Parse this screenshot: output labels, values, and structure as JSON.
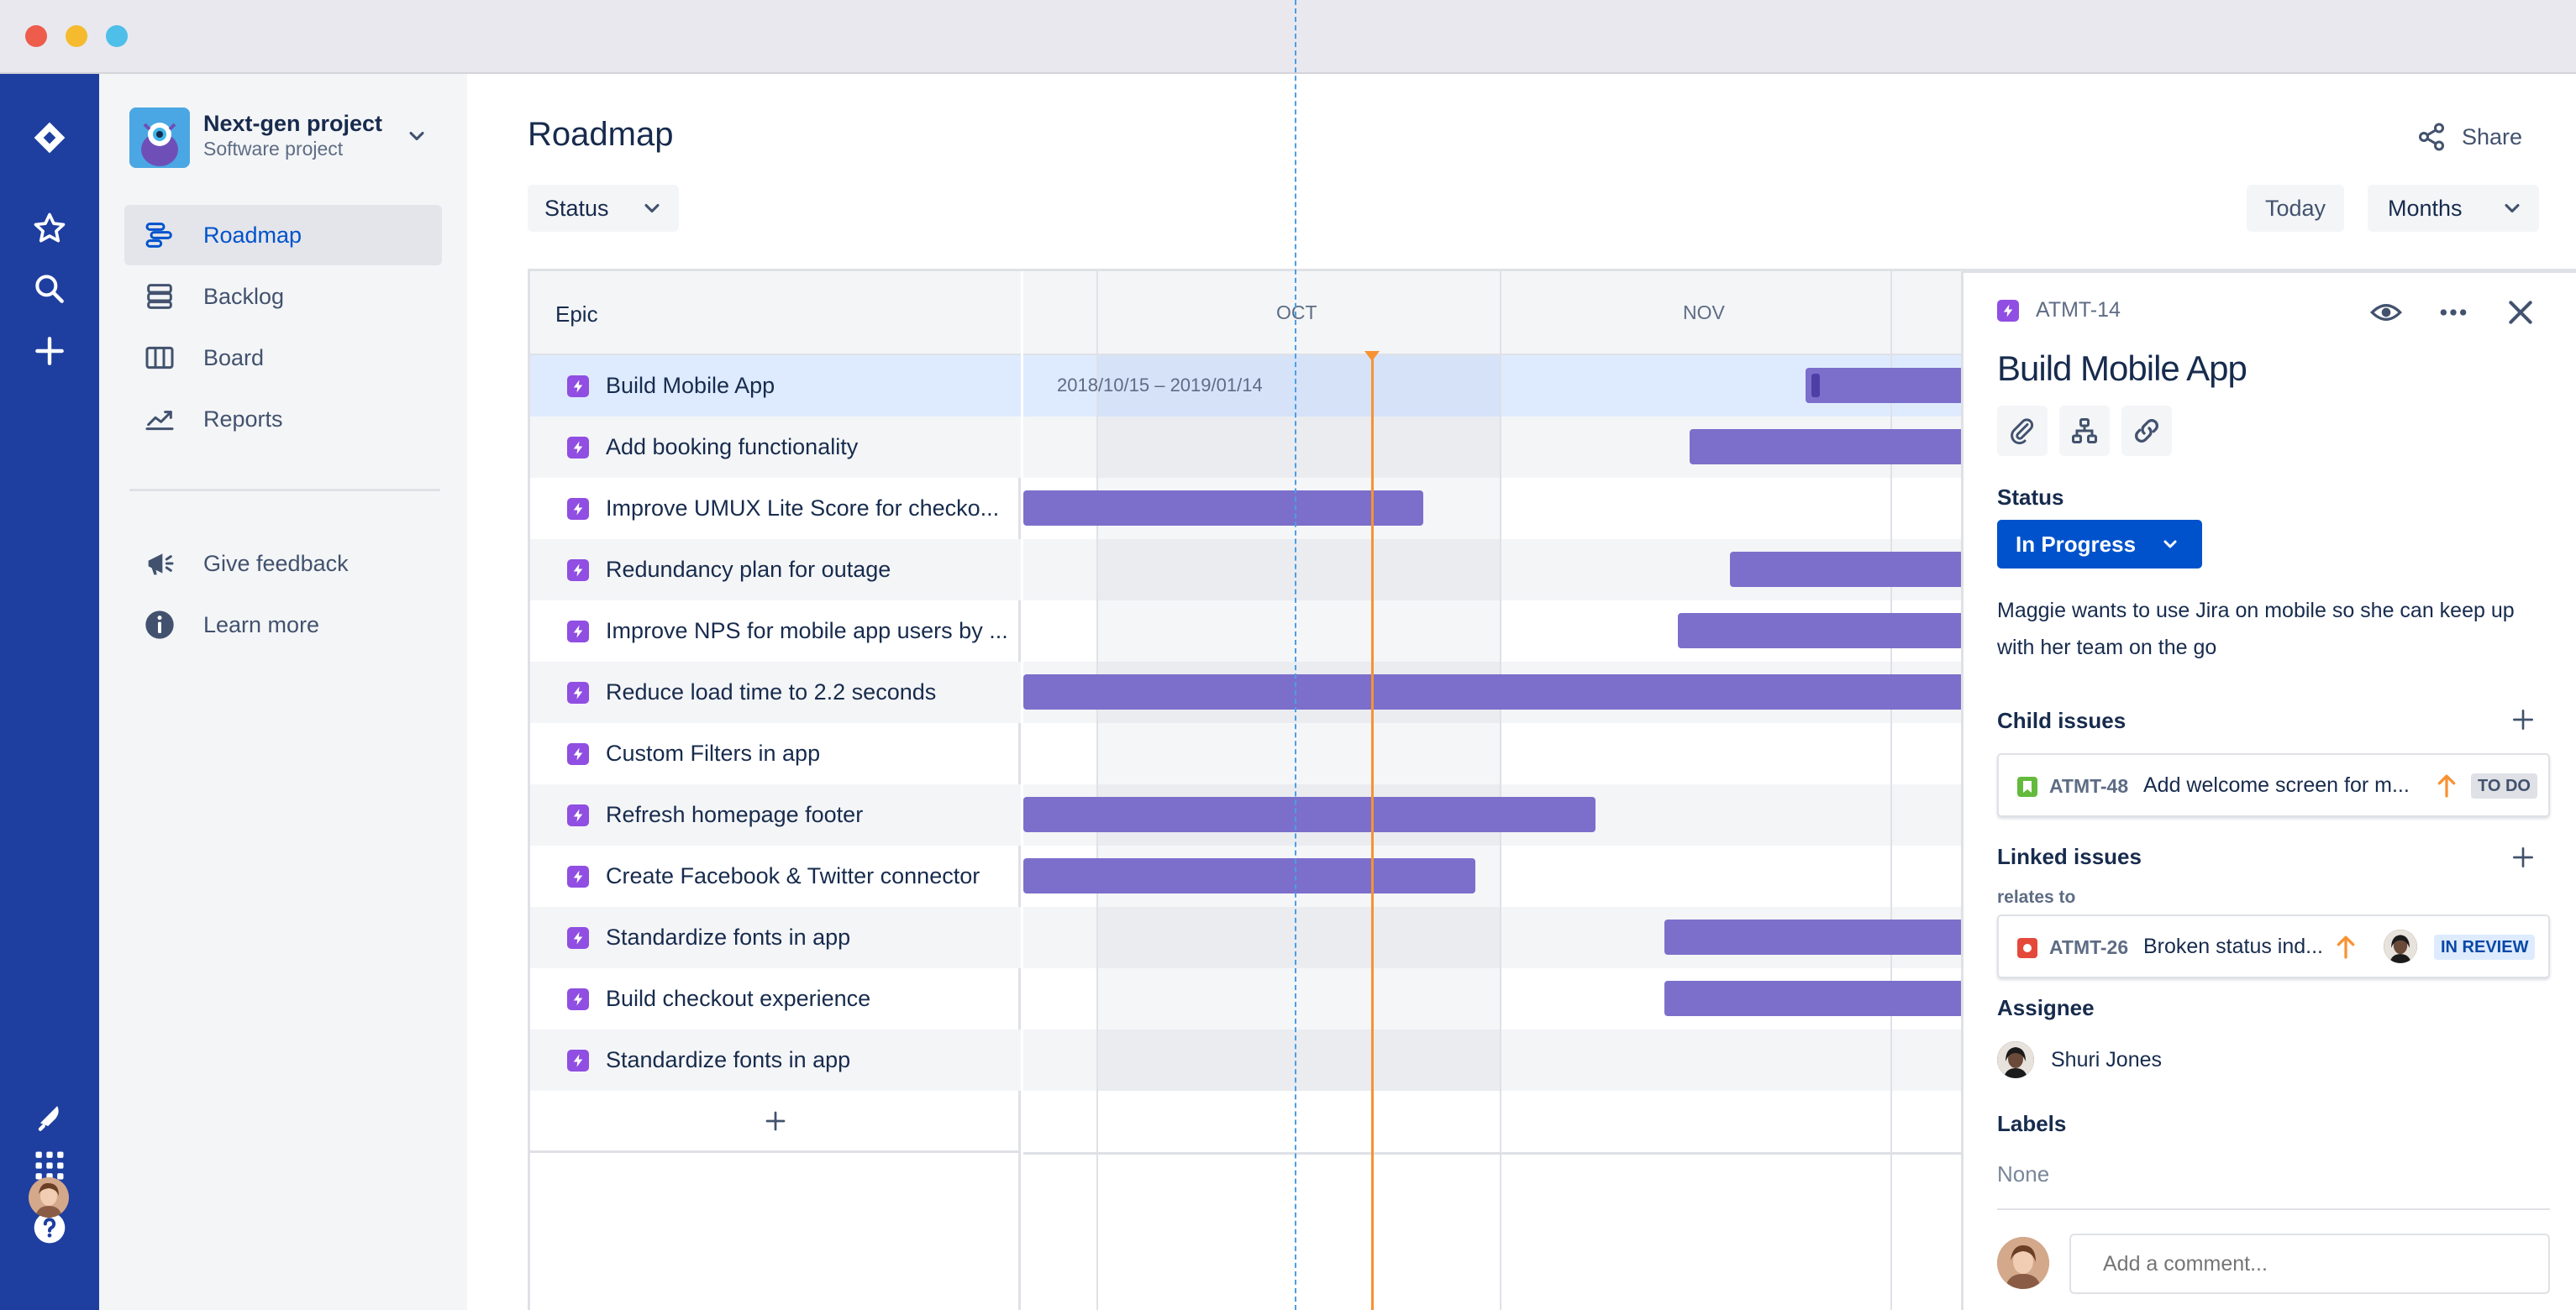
{
  "window": {
    "controls": [
      "close",
      "minimize",
      "maximize"
    ]
  },
  "global_nav": {
    "icons": [
      "jira-logo-icon",
      "star-icon",
      "search-icon",
      "plus-icon",
      "notifications-icon",
      "app-switcher-icon",
      "help-icon",
      "user-avatar"
    ],
    "background": "#1E3FA0"
  },
  "project": {
    "name": "Next-gen project",
    "type": "Software project"
  },
  "sidebar": {
    "items": [
      {
        "label": "Roadmap",
        "icon": "roadmap-icon",
        "active": true
      },
      {
        "label": "Backlog",
        "icon": "backlog-icon",
        "active": false
      },
      {
        "label": "Board",
        "icon": "board-icon",
        "active": false
      },
      {
        "label": "Reports",
        "icon": "reports-icon",
        "active": false
      }
    ],
    "secondary": [
      {
        "label": "Give feedback",
        "icon": "megaphone-icon"
      },
      {
        "label": "Learn more",
        "icon": "info-icon"
      }
    ]
  },
  "header": {
    "title": "Roadmap",
    "share_label": "Share",
    "status_filter": "Status",
    "today_label": "Today",
    "view_mode": "Months"
  },
  "roadmap": {
    "epic_header": "Epic",
    "months": [
      "OCT",
      "NOV"
    ],
    "selected_date_range": "2018/10/15 – 2019/01/14",
    "epics": [
      {
        "label": "Build Mobile App"
      },
      {
        "label": "Add booking functionality"
      },
      {
        "label": "Improve UMUX Lite Score for checko..."
      },
      {
        "label": "Redundancy plan for outage"
      },
      {
        "label": "Improve NPS for mobile app users by ..."
      },
      {
        "label": "Reduce load time to 2.2 seconds"
      },
      {
        "label": "Custom Filters in app"
      },
      {
        "label": "Refresh homepage footer"
      },
      {
        "label": "Create Facebook & Twitter connector"
      },
      {
        "label": "Standardize fonts in app"
      },
      {
        "label": "Build checkout experience"
      },
      {
        "label": "Standardize fonts in app"
      }
    ],
    "add_label": "+",
    "bar_color": "#7B6FCB",
    "today_color": "#F79233"
  },
  "panel": {
    "issue_key": "ATMT-14",
    "title": "Build Mobile App",
    "status_label": "Status",
    "status_value": "In Progress",
    "description": "Maggie wants to use Jira on mobile so she can keep up with her team on the go",
    "child_issues_label": "Child issues",
    "child_issues": [
      {
        "key": "ATMT-48",
        "summary": "Add welcome screen for m...",
        "status": "TO DO",
        "priority": "high"
      }
    ],
    "linked_issues_label": "Linked issues",
    "relates_to_label": "relates to",
    "linked_issues": [
      {
        "key": "ATMT-26",
        "summary": "Broken status ind...",
        "status": "IN REVIEW",
        "priority": "high"
      }
    ],
    "assignee_label": "Assignee",
    "assignee_name": "Shuri Jones",
    "labels_label": "Labels",
    "labels_value": "None",
    "comment_placeholder": "Add a comment...",
    "accent": "#0052CC"
  }
}
